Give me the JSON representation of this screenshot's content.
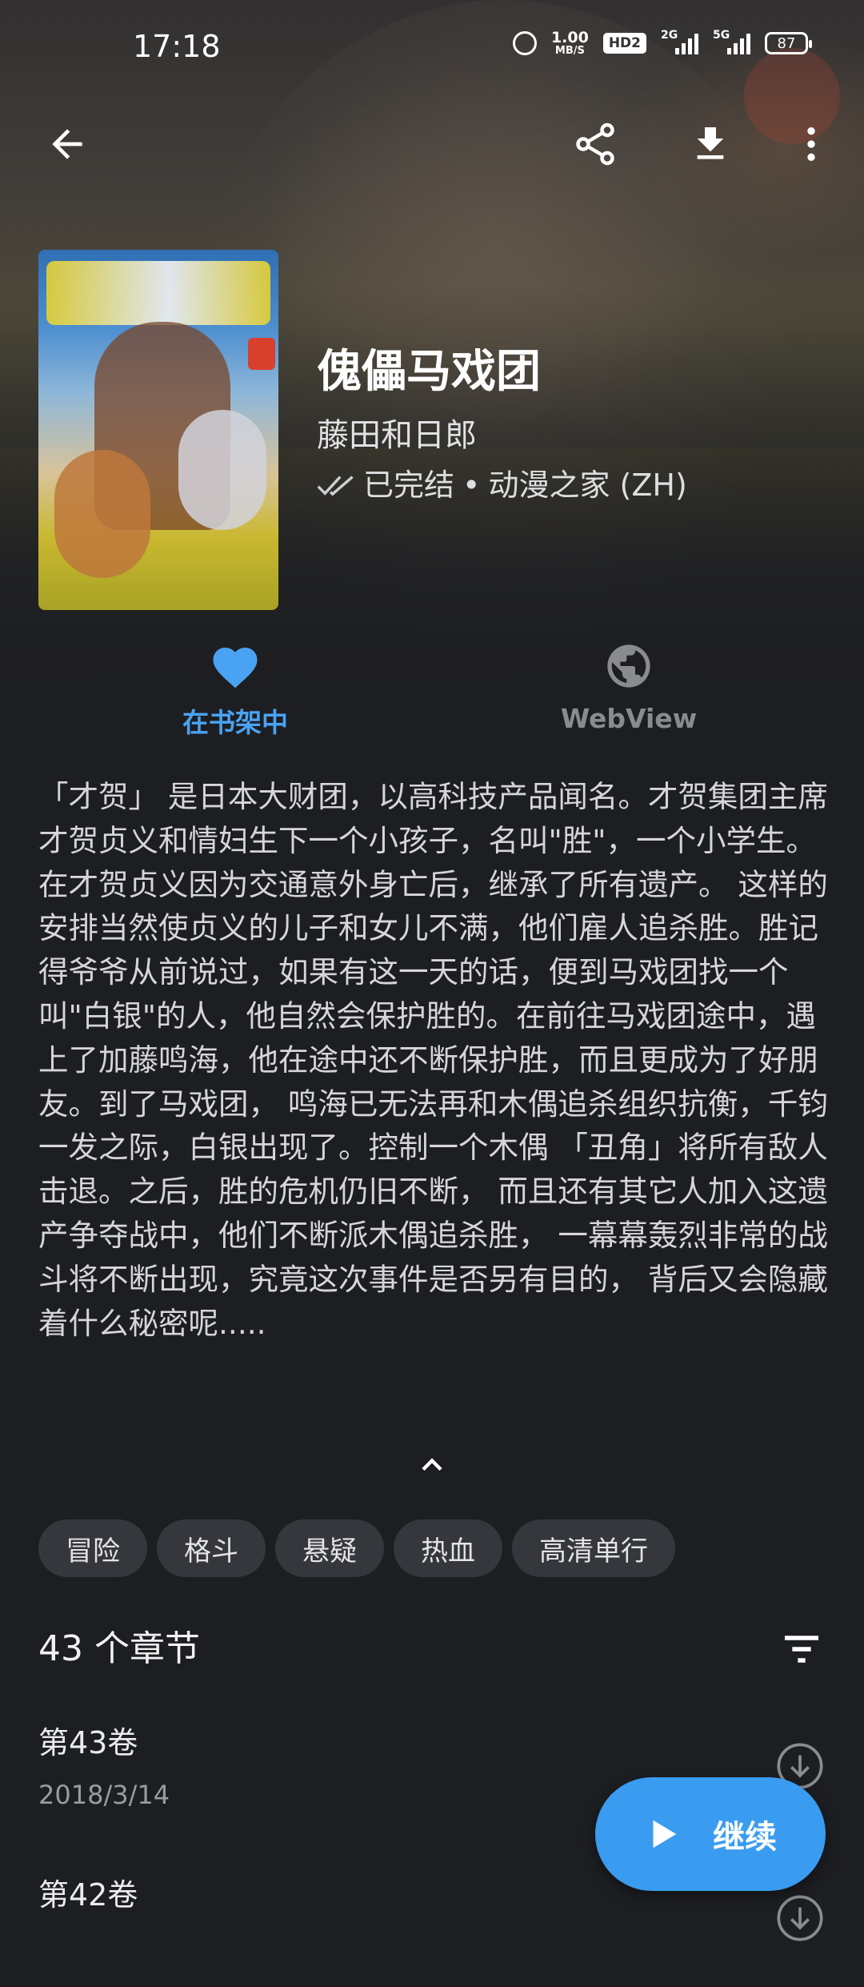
{
  "status_bar": {
    "time": "17:18",
    "net_speed_value": "1.00",
    "net_speed_unit": "MB/S",
    "hd_badge": "HD2",
    "sig1_label": "2G",
    "sig2_label": "5G",
    "battery": "87"
  },
  "icons": {
    "back": "arrow-left-icon",
    "share": "share-icon",
    "download": "download-icon",
    "more": "more-vertical-icon",
    "favorite": "heart-icon",
    "webview": "globe-icon",
    "collapse": "chevron-up-icon",
    "filter": "filter-icon",
    "chapter_download": "download-circle-icon",
    "play": "play-icon",
    "completed": "double-check-icon"
  },
  "manga": {
    "title": "傀儡马戏团",
    "author": "藤田和日郎",
    "status": "已完结",
    "separator": "•",
    "source": "动漫之家 (ZH)"
  },
  "actions": {
    "favorite_label": "在书架中",
    "webview_label": "WebView"
  },
  "description": "「才贺」 是日本大财团，以高科技产品闻名。才贺集团主席才贺贞义和情妇生下一个小孩子，名叫\"胜\"，一个小学生。在才贺贞义因为交通意外身亡后，继承了所有遗产。 这样的安排当然使贞义的儿子和女儿不满，他们雇人追杀胜。胜记得爷爷从前说过，如果有这一天的话，便到马戏团找一个叫\"白银\"的人，他自然会保护胜的。在前往马戏团途中，遇上了加藤鸣海，他在途中还不断保护胜，而且更成为了好朋友。到了马戏团， 鸣海已无法再和木偶追杀组织抗衡，千钧一发之际，白银出现了。控制一个木偶 「丑角」将所有敌人击退。之后，胜的危机仍旧不断， 而且还有其它人加入这遗产争夺战中，他们不断派木偶追杀胜， 一幕幕轰烈非常的战斗将不断出现，究竟这次事件是否另有目的， 背后又会隐藏着什么秘密呢.....",
  "tags": [
    "冒险",
    "格斗",
    "悬疑",
    "热血",
    "高清单行"
  ],
  "chapters_header": "43 个章节",
  "chapters": [
    {
      "name": "第43卷",
      "date": "2018/3/14"
    },
    {
      "name": "第42卷",
      "date": ""
    }
  ],
  "fab_label": "继续",
  "colors": {
    "accent": "#3a9cf0",
    "background": "#1d1e22",
    "tag_bg": "#36373c"
  }
}
